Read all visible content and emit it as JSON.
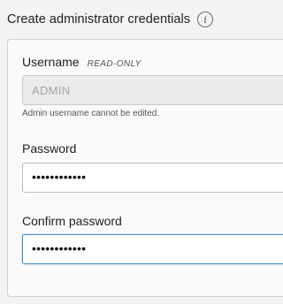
{
  "header": {
    "title": "Create administrator credentials",
    "info_icon": "info-icon",
    "info_glyph": "i"
  },
  "username": {
    "label": "Username",
    "readonly_tag": "READ-ONLY",
    "value": "ADMIN",
    "helper": "Admin username cannot be edited."
  },
  "password": {
    "label": "Password",
    "masked_value": "••••••••••••"
  },
  "confirm_password": {
    "label": "Confirm password",
    "masked_value": "••••••••••••"
  },
  "colors": {
    "focus_border": "#3b8fc9",
    "disabled_bg": "#ebebeb"
  }
}
